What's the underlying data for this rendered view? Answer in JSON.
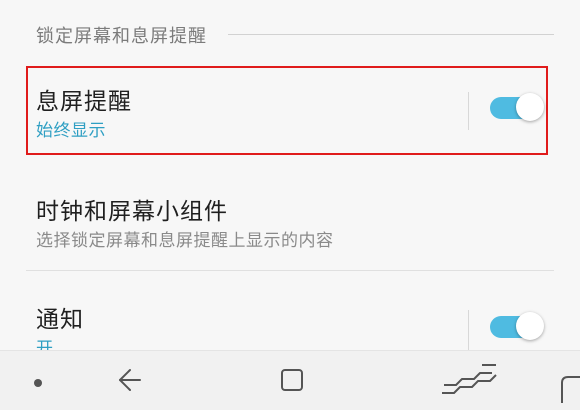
{
  "section": {
    "header": "锁定屏幕和息屏提醒"
  },
  "rows": [
    {
      "title": "息屏提醒",
      "subtitle": "始终显示",
      "toggle_on": true
    },
    {
      "title": "时钟和屏幕小组件",
      "subtitle": "选择锁定屏幕和息屏提醒上显示的内容"
    },
    {
      "title": "通知",
      "subtitle": "开",
      "toggle_on": true
    }
  ],
  "colors": {
    "accent": "#2f9fc3",
    "toggle_track": "#4fbbe1",
    "highlight_border": "#e01b1b"
  },
  "navbar": {
    "icons": [
      "dot-icon",
      "back-icon",
      "recents-icon",
      "overview-gesture-icon",
      "home-icon"
    ]
  }
}
